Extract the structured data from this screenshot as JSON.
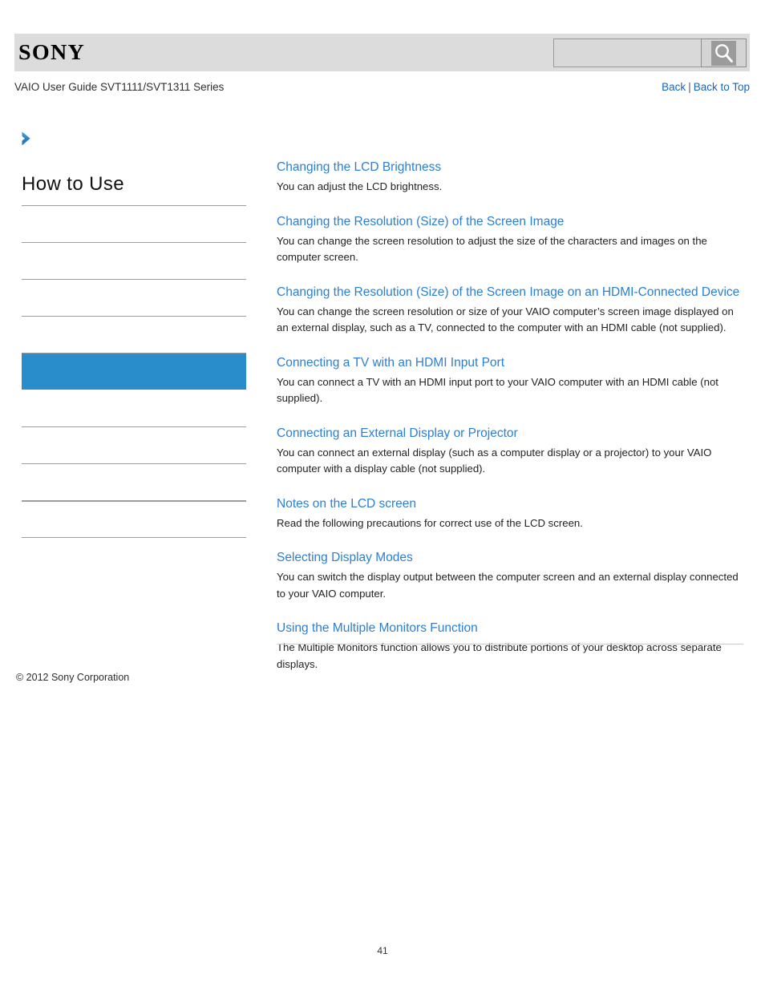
{
  "header": {
    "brand": "SONY",
    "search": {
      "value": "",
      "placeholder": "",
      "button_icon": "search-icon"
    }
  },
  "guide_bar": {
    "title": "VAIO User Guide SVT1111/SVT1311 Series",
    "back_label": "Back",
    "separator": "|",
    "back_to_top_label": "Back to Top"
  },
  "sidebar": {
    "expand_icon": "chevron-right-icon",
    "title": "How to Use",
    "items": [
      {
        "label": "",
        "active": false,
        "style": "normal"
      },
      {
        "label": "",
        "active": false,
        "style": "normal"
      },
      {
        "label": "",
        "active": false,
        "style": "normal"
      },
      {
        "label": "",
        "active": false,
        "style": "normal"
      },
      {
        "label": "",
        "active": true,
        "style": "normal"
      },
      {
        "label": "",
        "active": false,
        "style": "normal"
      },
      {
        "label": "",
        "active": false,
        "style": "normal"
      },
      {
        "label": "",
        "active": false,
        "style": "thick"
      },
      {
        "label": "",
        "active": false,
        "style": "normal"
      }
    ]
  },
  "main": {
    "entries": [
      {
        "title": "Changing the LCD Brightness",
        "description": "You can adjust the LCD brightness."
      },
      {
        "title": "Changing the Resolution (Size) of the Screen Image",
        "description": "You can change the screen resolution to adjust the size of the characters and images on the computer screen."
      },
      {
        "title": "Changing the Resolution (Size) of the Screen Image on an HDMI-Connected Device",
        "description": "You can change the screen resolution or size of your VAIO computer’s screen image displayed on an external display, such as a TV, connected to the computer with an HDMI cable (not supplied)."
      },
      {
        "title": "Connecting a TV with an HDMI Input Port",
        "description": "You can connect a TV with an HDMI input port to your VAIO computer with an HDMI cable (not supplied)."
      },
      {
        "title": "Connecting an External Display or Projector",
        "description": "You can connect an external display (such as a computer display or a projector) to your VAIO computer with a display cable (not supplied)."
      },
      {
        "title": "Notes on the LCD screen",
        "description": "Read the following precautions for correct use of the LCD screen."
      },
      {
        "title": "Selecting Display Modes",
        "description": "You can switch the display output between the computer screen and an external display connected to your VAIO computer."
      },
      {
        "title": "Using the Multiple Monitors Function",
        "description": "The Multiple Monitors function allows you to distribute portions of your desktop across separate displays."
      }
    ]
  },
  "footer": {
    "copyright": "© 2012 Sony Corporation",
    "page_number": "41"
  },
  "colors": {
    "link_blue": "#2a7fd4",
    "nav_active_blue": "#2a8dcb",
    "header_band_gray": "#dcdcdc",
    "top_link_blue": "#1565c0"
  }
}
